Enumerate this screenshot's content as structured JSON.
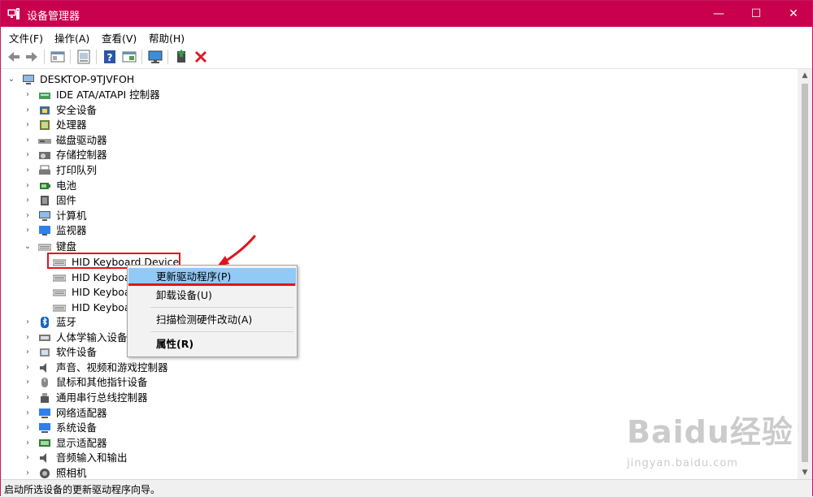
{
  "window": {
    "title": "设备管理器",
    "min": "—",
    "max": "☐",
    "close": "✕"
  },
  "menu": [
    "文件(F)",
    "操作(A)",
    "查看(V)",
    "帮助(H)"
  ],
  "toolbar": [
    "back-icon",
    "forward-icon",
    "show-hide-tree-icon",
    "properties-icon",
    "help-icon",
    "action-icon",
    "monitor-icon",
    "update-driver-icon",
    "uninstall-icon"
  ],
  "tree": {
    "root": "DESKTOP-9TJVFOH",
    "categories_top": [
      {
        "label": "IDE ATA/ATAPI 控制器",
        "icon": "ide-controller-icon"
      },
      {
        "label": "安全设备",
        "icon": "security-device-icon"
      },
      {
        "label": "处理器",
        "icon": "processor-icon"
      },
      {
        "label": "磁盘驱动器",
        "icon": "disk-drive-icon"
      },
      {
        "label": "存储控制器",
        "icon": "storage-controller-icon"
      },
      {
        "label": "打印队列",
        "icon": "print-queue-icon"
      },
      {
        "label": "电池",
        "icon": "battery-icon"
      },
      {
        "label": "固件",
        "icon": "firmware-icon"
      },
      {
        "label": "计算机",
        "icon": "computer-icon"
      },
      {
        "label": "监视器",
        "icon": "monitor-icon"
      }
    ],
    "keyboard": {
      "label": "键盘",
      "children": [
        "HID Keyboard Device",
        "HID Keyboa",
        "HID Keyboa",
        "HID Keyboa"
      ]
    },
    "categories_bottom": [
      {
        "label": "蓝牙",
        "icon": "bluetooth-icon"
      },
      {
        "label": "人体学输入设备",
        "icon": "hid-icon"
      },
      {
        "label": "软件设备",
        "icon": "software-device-icon"
      },
      {
        "label": "声音、视频和游戏控制器",
        "icon": "audio-icon"
      },
      {
        "label": "鼠标和其他指针设备",
        "icon": "mouse-icon"
      },
      {
        "label": "通用串行总线控制器",
        "icon": "usb-icon"
      },
      {
        "label": "网络适配器",
        "icon": "network-adapter-icon"
      },
      {
        "label": "系统设备",
        "icon": "system-device-icon"
      },
      {
        "label": "显示适配器",
        "icon": "display-adapter-icon"
      },
      {
        "label": "音频输入和输出",
        "icon": "audio-io-icon"
      },
      {
        "label": "照相机",
        "icon": "camera-icon"
      }
    ]
  },
  "context_menu": {
    "update_driver": "更新驱动程序(P)",
    "uninstall": "卸载设备(U)",
    "scan": "扫描检测硬件改动(A)",
    "properties": "属性(R)"
  },
  "status": "启动所选设备的更新驱动程序向导。",
  "watermark": {
    "brand": "Baidu经验",
    "url": "jingyan.baidu.com"
  },
  "colors": {
    "titlebar": "#c8004d",
    "highlight": "#e0141e",
    "menu_hover": "#91c9f7"
  }
}
